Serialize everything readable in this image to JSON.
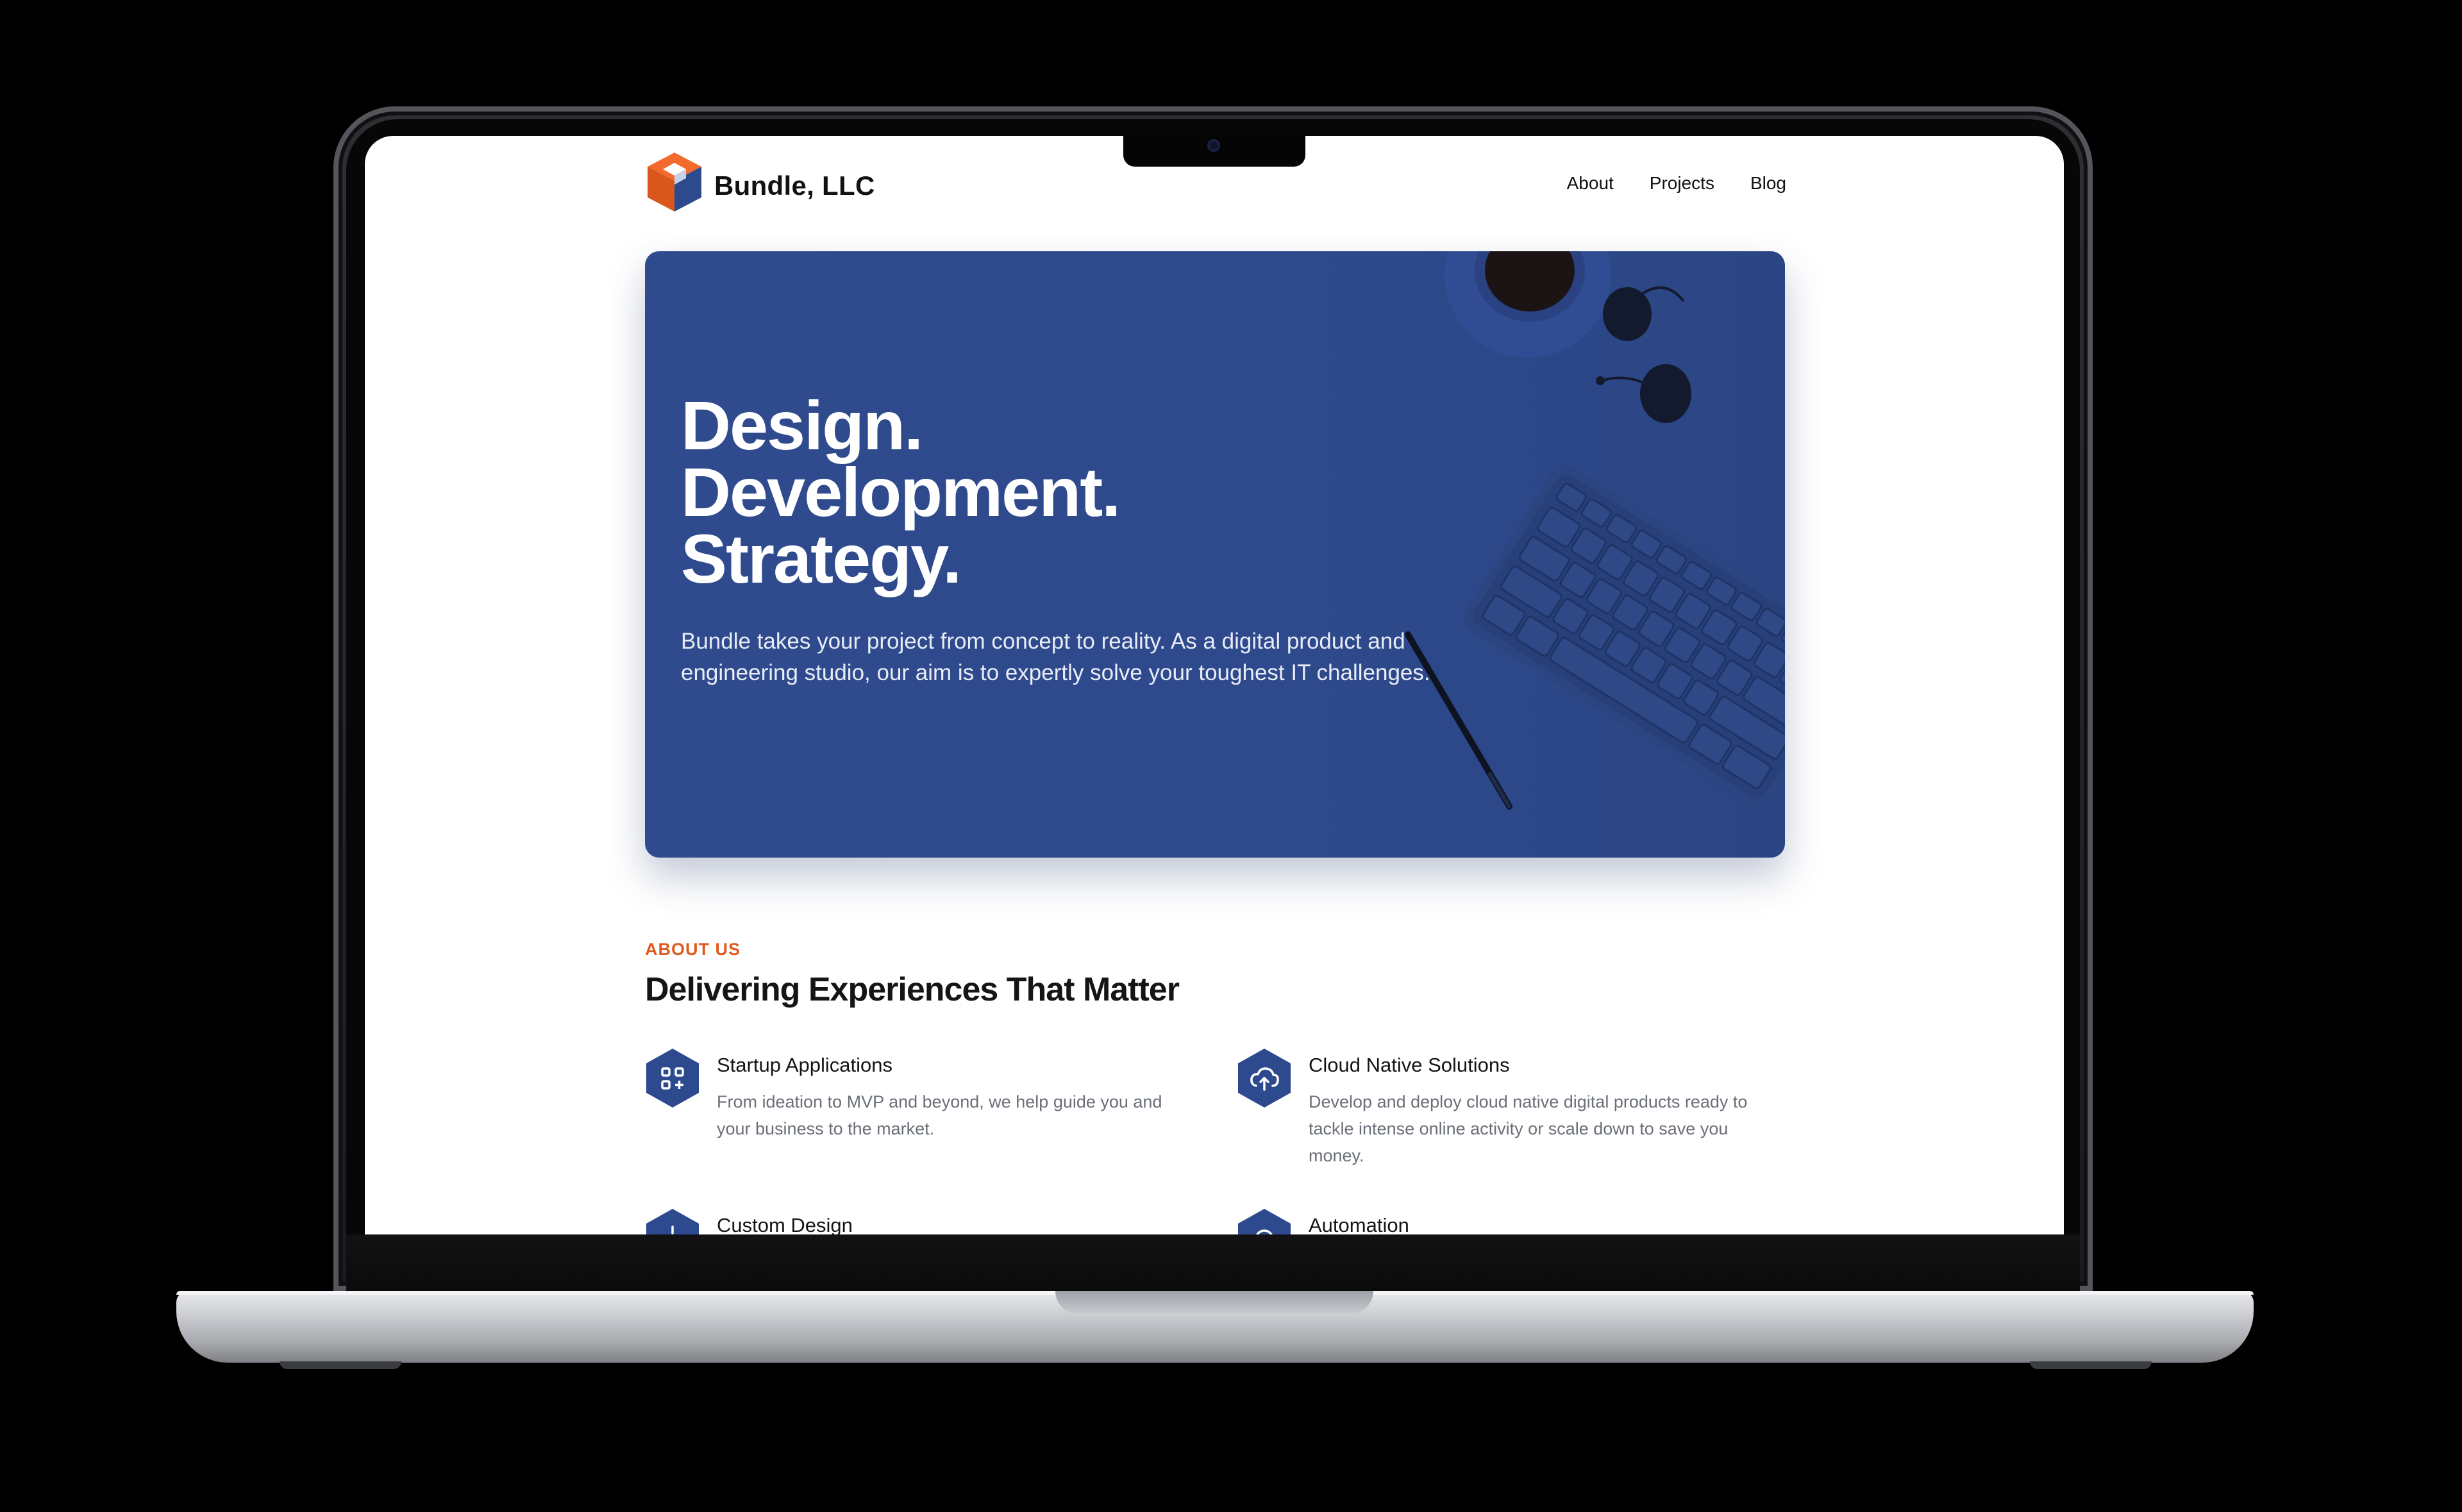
{
  "nav": {
    "brand": "Bundle, LLC",
    "links": [
      "About",
      "Projects",
      "Blog"
    ]
  },
  "hero": {
    "title_lines": [
      "Design.",
      "Development.",
      "Strategy."
    ],
    "description": "Bundle takes your project from concept to reality. As a digital product and engineering studio, our aim is to expertly solve your toughest IT challenges."
  },
  "about": {
    "eyebrow": "ABOUT US",
    "title": "Delivering Experiences That Matter",
    "features": [
      {
        "title": "Startup Applications",
        "description": "From ideation to MVP and beyond, we help guide you and your business to the market.",
        "icon": "apps-icon"
      },
      {
        "title": "Cloud Native Solutions",
        "description": "Develop and deploy cloud native digital products ready to tackle intense online activity or scale down to save you money.",
        "icon": "cloud-upload-icon"
      },
      {
        "title": "Custom Design",
        "description": "",
        "icon": "sparkle-icon"
      },
      {
        "title": "Automation",
        "description": "",
        "icon": "refresh-icon"
      }
    ]
  },
  "colors": {
    "hero_blue": "#2f4b8e",
    "accent_orange": "#e05a1e",
    "icon_navy": "#2d4a8e"
  }
}
